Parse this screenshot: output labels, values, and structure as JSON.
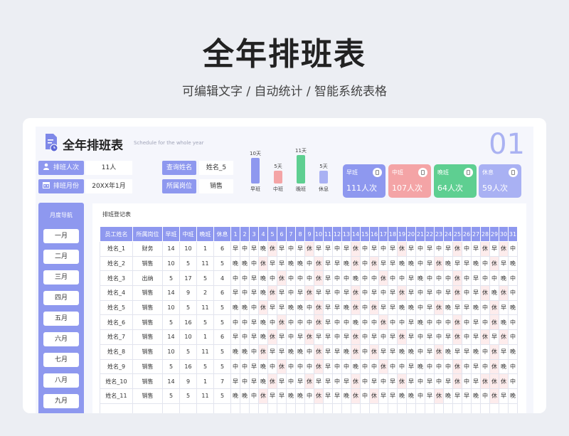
{
  "hero": {
    "title": "全年排班表",
    "subtitle": "可编辑文字 / 自动统计 / 智能系统表格"
  },
  "app": {
    "title": "全年排班表",
    "subtitle": "Schedule for the whole year",
    "page_number": "01"
  },
  "info": {
    "shift_count_label": "排班人次",
    "shift_count_value": "11人",
    "month_label": "排班月份",
    "month_value": "20XX年1月",
    "query_name_label": "查询姓名",
    "query_name_value": "姓名_5",
    "dept_label": "所属岗位",
    "dept_value": "销售"
  },
  "bar_chart": {
    "colors": {
      "早班": "#8e98ef",
      "中班": "#f4a4a6",
      "晚班": "#5ecf91",
      "休息": "#a9b1f3"
    },
    "items": [
      {
        "label": "早班",
        "value_label": "10天",
        "value": 10
      },
      {
        "label": "中班",
        "value_label": "5天",
        "value": 5
      },
      {
        "label": "晚班",
        "value_label": "11天",
        "value": 11
      },
      {
        "label": "休息",
        "value_label": "5天",
        "value": 5
      }
    ]
  },
  "stats": [
    {
      "title": "早班",
      "value": "111人次",
      "color": "#8e98ef"
    },
    {
      "title": "中班",
      "value": "107人次",
      "color": "#f4a4a6"
    },
    {
      "title": "晚班",
      "value": "64人次",
      "color": "#5ecf91"
    },
    {
      "title": "休息",
      "value": "59人次",
      "color": "#a9b1f3"
    }
  ],
  "sidebar": {
    "title": "月度导航",
    "months": [
      "一月",
      "二月",
      "三月",
      "四月",
      "五月",
      "六月",
      "七月",
      "八月",
      "九月"
    ]
  },
  "table": {
    "title": "排班登记表",
    "headers": [
      "员工姓名",
      "所属岗位",
      "早班",
      "中班",
      "晚班",
      "休息",
      "1",
      "2",
      "3",
      "4",
      "5",
      "6",
      "7",
      "8",
      "9",
      "10",
      "11",
      "12",
      "13",
      "14",
      "15",
      "16",
      "17",
      "18",
      "19",
      "20",
      "21",
      "22",
      "23",
      "24",
      "25",
      "26",
      "27",
      "28",
      "29",
      "30",
      "31"
    ],
    "rows": [
      {
        "name": "姓名_1",
        "dept": "财务",
        "early": "14",
        "mid": "10",
        "late": "1",
        "rest": "6",
        "days": [
          "早",
          "中",
          "早",
          "晚",
          "休",
          "早",
          "中",
          "早",
          "休",
          "早",
          "早",
          "中",
          "早",
          "休",
          "中",
          "早",
          "中",
          "早",
          "休",
          "早",
          "中",
          "早",
          "中",
          "早",
          "休",
          "中",
          "早",
          "休",
          "早",
          "休",
          "中"
        ]
      },
      {
        "name": "姓名_2",
        "dept": "销售",
        "early": "10",
        "mid": "5",
        "late": "11",
        "rest": "5",
        "days": [
          "晚",
          "晚",
          "中",
          "休",
          "早",
          "早",
          "晚",
          "晚",
          "中",
          "休",
          "早",
          "早",
          "晚",
          "休",
          "中",
          "休",
          "早",
          "早",
          "晚",
          "晚",
          "中",
          "早",
          "休",
          "晚",
          "早",
          "早",
          "晚",
          "中",
          "休",
          "早",
          "晚"
        ]
      },
      {
        "name": "姓名_3",
        "dept": "出纳",
        "early": "5",
        "mid": "17",
        "late": "5",
        "rest": "4",
        "days": [
          "中",
          "中",
          "早",
          "晚",
          "中",
          "休",
          "中",
          "中",
          "中",
          "休",
          "早",
          "中",
          "中",
          "晚",
          "中",
          "中",
          "休",
          "中",
          "中",
          "早",
          "晚",
          "中",
          "中",
          "中",
          "休",
          "中",
          "早",
          "中",
          "中",
          "晚",
          "中"
        ]
      },
      {
        "name": "姓名_4",
        "dept": "销售",
        "early": "14",
        "mid": "9",
        "late": "2",
        "rest": "6",
        "days": [
          "早",
          "中",
          "早",
          "晚",
          "休",
          "早",
          "中",
          "早",
          "休",
          "早",
          "早",
          "中",
          "早",
          "休",
          "中",
          "早",
          "中",
          "早",
          "休",
          "早",
          "中",
          "早",
          "中",
          "早",
          "休",
          "中",
          "早",
          "休",
          "晚",
          "休",
          "中"
        ]
      },
      {
        "name": "姓名_5",
        "dept": "销售",
        "early": "10",
        "mid": "5",
        "late": "11",
        "rest": "5",
        "days": [
          "晚",
          "晚",
          "中",
          "休",
          "早",
          "早",
          "晚",
          "晚",
          "中",
          "休",
          "早",
          "早",
          "晚",
          "休",
          "中",
          "休",
          "早",
          "早",
          "晚",
          "晚",
          "中",
          "早",
          "休",
          "晚",
          "早",
          "早",
          "晚",
          "中",
          "休",
          "早",
          "晚"
        ]
      },
      {
        "name": "姓名_6",
        "dept": "销售",
        "early": "5",
        "mid": "16",
        "late": "5",
        "rest": "5",
        "days": [
          "中",
          "中",
          "早",
          "晚",
          "中",
          "休",
          "中",
          "中",
          "中",
          "休",
          "早",
          "中",
          "中",
          "晚",
          "中",
          "中",
          "休",
          "中",
          "中",
          "早",
          "晚",
          "中",
          "中",
          "中",
          "休",
          "中",
          "早",
          "中",
          "休",
          "晚",
          "中"
        ]
      },
      {
        "name": "姓名_7",
        "dept": "销售",
        "early": "14",
        "mid": "10",
        "late": "1",
        "rest": "6",
        "days": [
          "早",
          "中",
          "早",
          "晚",
          "休",
          "早",
          "中",
          "早",
          "休",
          "早",
          "早",
          "中",
          "早",
          "休",
          "中",
          "早",
          "中",
          "早",
          "休",
          "早",
          "中",
          "早",
          "中",
          "早",
          "休",
          "中",
          "早",
          "休",
          "早",
          "休",
          "中"
        ]
      },
      {
        "name": "姓名_8",
        "dept": "销售",
        "early": "10",
        "mid": "5",
        "late": "11",
        "rest": "5",
        "days": [
          "晚",
          "晚",
          "中",
          "休",
          "早",
          "早",
          "晚",
          "晚",
          "中",
          "休",
          "早",
          "早",
          "晚",
          "休",
          "中",
          "休",
          "早",
          "早",
          "晚",
          "晚",
          "中",
          "早",
          "休",
          "晚",
          "早",
          "早",
          "晚",
          "中",
          "休",
          "早",
          "晚"
        ]
      },
      {
        "name": "姓名_9",
        "dept": "销售",
        "early": "5",
        "mid": "16",
        "late": "5",
        "rest": "5",
        "days": [
          "中",
          "中",
          "早",
          "晚",
          "中",
          "休",
          "中",
          "中",
          "中",
          "休",
          "早",
          "中",
          "中",
          "晚",
          "中",
          "中",
          "休",
          "中",
          "中",
          "早",
          "晚",
          "中",
          "中",
          "中",
          "休",
          "中",
          "早",
          "中",
          "休",
          "晚",
          "中"
        ]
      },
      {
        "name": "姓名_10",
        "dept": "销售",
        "early": "14",
        "mid": "9",
        "late": "1",
        "rest": "7",
        "days": [
          "早",
          "中",
          "早",
          "晚",
          "休",
          "早",
          "中",
          "早",
          "休",
          "早",
          "早",
          "中",
          "早",
          "休",
          "中",
          "早",
          "中",
          "早",
          "休",
          "早",
          "中",
          "早",
          "中",
          "早",
          "休",
          "中",
          "早",
          "休",
          "休",
          "休",
          "中"
        ]
      },
      {
        "name": "姓名_11",
        "dept": "销售",
        "early": "5",
        "mid": "5",
        "late": "11",
        "rest": "5",
        "days": [
          "晚",
          "晚",
          "中",
          "休",
          "早",
          "早",
          "晚",
          "晚",
          "中",
          "休",
          "早",
          "早",
          "晚",
          "休",
          "中",
          "休",
          "早",
          "早",
          "晚",
          "晚",
          "中",
          "早",
          "休",
          "晚",
          "早",
          "早",
          "晚",
          "中",
          "休",
          "早",
          "晚"
        ]
      }
    ]
  }
}
